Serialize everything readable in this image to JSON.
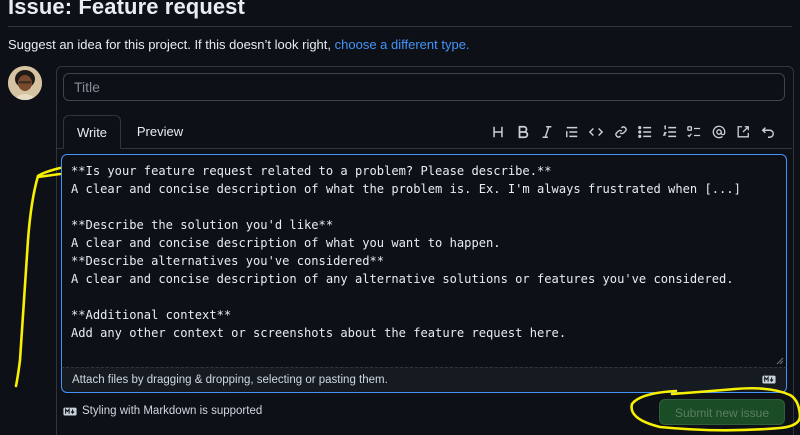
{
  "page": {
    "heading": "Issue: Feature request",
    "subtitle_text": "Suggest an idea for this project. If this doesn’t look right, ",
    "subtitle_link": "choose a different type."
  },
  "form": {
    "title_placeholder": "Title",
    "tabs": {
      "write": "Write",
      "preview": "Preview"
    },
    "toolbar_icons": [
      "heading-icon",
      "bold-icon",
      "italic-icon",
      "quote-icon",
      "code-icon",
      "link-icon",
      "unordered-list-icon",
      "ordered-list-icon",
      "task-list-icon",
      "mention-icon",
      "cross-reference-icon",
      "undo-icon"
    ],
    "body_lines": [
      "**Is your feature request related to a problem? Please describe.**",
      "A clear and concise description of what the problem is. Ex. I'm always frustrated when [...]",
      "",
      "**Describe the solution you'd like**",
      "A clear and concise description of what you want to happen.",
      "**Describe alternatives you've considered**",
      "A clear and concise description of any alternative solutions or features you've considered.",
      "",
      "**Additional context**",
      "Add any other context or screenshots about the feature request here."
    ],
    "attach_text": "Attach files by dragging & dropping, selecting or pasting them.",
    "markdown_note": "Styling with Markdown is supported",
    "submit_label": "Submit new issue"
  },
  "colors": {
    "background": "#0d1117",
    "link": "#4493f8",
    "focus_border": "#4493f8",
    "submit_disabled_bg": "#1a4d25",
    "annotation_highlighter": "#f7f000"
  }
}
